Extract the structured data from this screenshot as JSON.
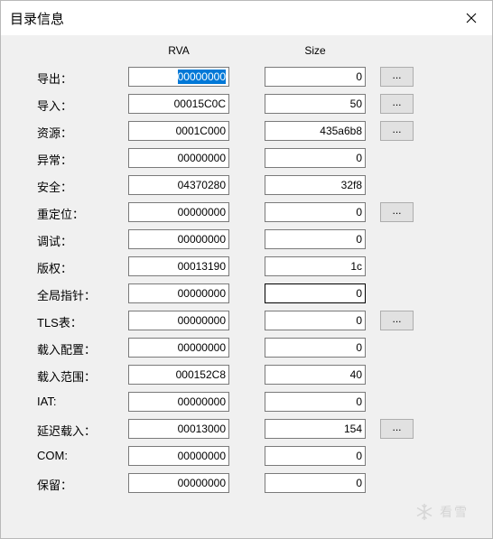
{
  "window": {
    "title": "目录信息"
  },
  "columns": {
    "rva": "RVA",
    "size": "Size"
  },
  "button_label": "...",
  "rows": [
    {
      "label": "导出：",
      "rva": "00000000",
      "size": "0",
      "button": true
    },
    {
      "label": "导入：",
      "rva": "00015C0C",
      "size": "50",
      "button": true
    },
    {
      "label": "资源：",
      "rva": "0001C000",
      "size": "435a6b8",
      "button": true
    },
    {
      "label": "异常：",
      "rva": "00000000",
      "size": "0",
      "button": false
    },
    {
      "label": "安全：",
      "rva": "04370280",
      "size": "32f8",
      "button": false
    },
    {
      "label": "重定位：",
      "rva": "00000000",
      "size": "0",
      "button": true
    },
    {
      "label": "调试：",
      "rva": "00000000",
      "size": "0",
      "button": false
    },
    {
      "label": "版权：",
      "rva": "00013190",
      "size": "1c",
      "button": false
    },
    {
      "label": "全局指针：",
      "rva": "00000000",
      "size": "0",
      "button": false
    },
    {
      "label": "TLS表：",
      "rva": "00000000",
      "size": "0",
      "button": true
    },
    {
      "label": "载入配置：",
      "rva": "00000000",
      "size": "0",
      "button": false
    },
    {
      "label": "载入范围：",
      "rva": "000152C8",
      "size": "40",
      "button": false
    },
    {
      "label": "IAT:",
      "rva": "00000000",
      "size": "0",
      "button": false
    },
    {
      "label": "延迟载入：",
      "rva": "00013000",
      "size": "154",
      "button": true
    },
    {
      "label": "COM:",
      "rva": "00000000",
      "size": "0",
      "button": false
    },
    {
      "label": "保留：",
      "rva": "00000000",
      "size": "0",
      "button": false
    }
  ],
  "watermark": {
    "text": "看雪",
    "icon": "snowflake-icon"
  }
}
